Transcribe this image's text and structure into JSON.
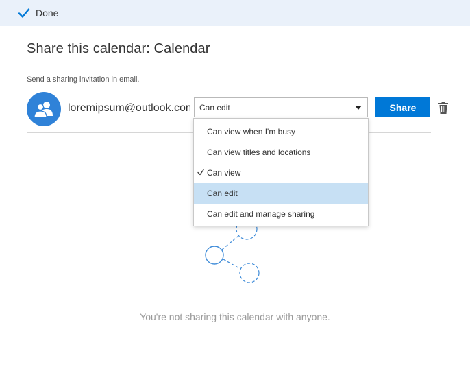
{
  "toolbar": {
    "done_label": "Done"
  },
  "dialog": {
    "title": "Share this calendar: Calendar",
    "subtitle": "Send a sharing invitation in email."
  },
  "recipient": {
    "email": "loremipsum@outlook.com",
    "permission": "Can edit"
  },
  "share_label": "Share",
  "permission_menu": {
    "items": [
      {
        "label": "Can view when I'm busy",
        "checked": false,
        "highlighted": false
      },
      {
        "label": "Can view titles and locations",
        "checked": false,
        "highlighted": false
      },
      {
        "label": "Can view",
        "checked": true,
        "highlighted": false
      },
      {
        "label": "Can edit",
        "checked": false,
        "highlighted": true
      },
      {
        "label": "Can edit and manage sharing",
        "checked": false,
        "highlighted": false
      }
    ]
  },
  "empty_state": {
    "message": "You're not sharing this calendar with anyone."
  },
  "colors": {
    "accent": "#0078d7",
    "avatar": "#2f82d8",
    "topbar": "#eaf1fa",
    "menu_highlight": "#c7e0f4"
  }
}
